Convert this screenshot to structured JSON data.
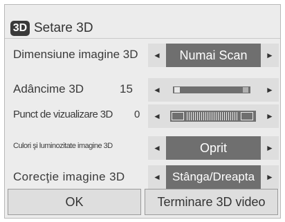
{
  "dialog": {
    "title": "Setare 3D",
    "logo_text": "3D"
  },
  "rows": [
    {
      "label": "Dimensiune imagine 3D",
      "value": "Numai Scan"
    },
    {
      "label": "Adâncime 3D",
      "level": "15",
      "slider_fraction": 0.06
    },
    {
      "label": "Punct de vizualizare 3D",
      "level": "0"
    },
    {
      "label": "Culori şi luminozitate imagine 3D",
      "value": "Oprit"
    },
    {
      "label": "Corecţie imagine 3D",
      "value": "Stânga/Dreapta"
    }
  ],
  "buttons": {
    "ok": "OK",
    "exit": "Terminare 3D video"
  },
  "arrows": {
    "left": "◄",
    "right": "►"
  }
}
